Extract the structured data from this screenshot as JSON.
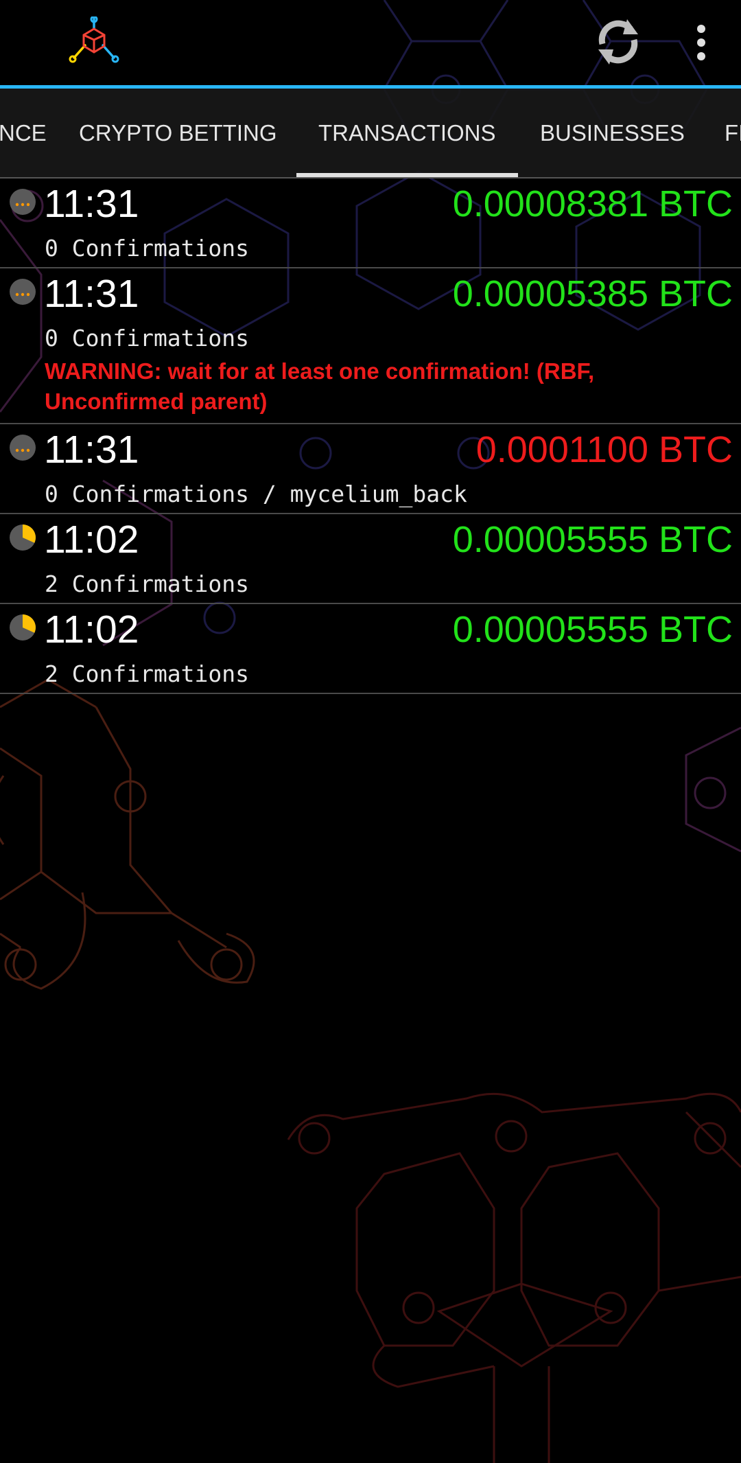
{
  "header": {
    "logo_icon": "mycelium-logo-icon",
    "refresh_icon": "refresh-icon",
    "overflow_icon": "more-vert-icon",
    "accent_color": "#29b6f6"
  },
  "tabs": [
    {
      "label": "BALANCE",
      "visible_text": "NCE",
      "selected": false
    },
    {
      "label": "CRYPTO BETTING",
      "visible_text": "CRYPTO BETTING",
      "selected": false
    },
    {
      "label": "TRANSACTIONS",
      "visible_text": "TRANSACTIONS",
      "selected": true
    },
    {
      "label": "BUSINESSES",
      "visible_text": "BUSINESSES",
      "selected": false
    },
    {
      "label": "FIO",
      "visible_text": "FI",
      "selected": false
    }
  ],
  "transactions": [
    {
      "time": "11:31",
      "amount": "0.00008381 BTC",
      "direction": "incoming",
      "confirmations": "0 Confirmations",
      "status_icon": "pending-dots-icon",
      "warning": ""
    },
    {
      "time": "11:31",
      "amount": "0.00005385 BTC",
      "direction": "incoming",
      "confirmations": "0 Confirmations",
      "status_icon": "pending-dots-icon",
      "warning": "WARNING: wait for at least one confirmation! (RBF, Unconfirmed parent)"
    },
    {
      "time": "11:31",
      "amount": "0.0001100 BTC",
      "direction": "outgoing",
      "confirmations": "0 Confirmations / mycelium_back",
      "status_icon": "pending-dots-icon",
      "warning": ""
    },
    {
      "time": "11:02",
      "amount": "0.00005555 BTC",
      "direction": "incoming",
      "confirmations": "2 Confirmations",
      "status_icon": "confirmation-pie-icon",
      "warning": ""
    },
    {
      "time": "11:02",
      "amount": "0.00005555 BTC",
      "direction": "incoming",
      "confirmations": "2 Confirmations",
      "status_icon": "confirmation-pie-icon",
      "warning": ""
    }
  ],
  "colors": {
    "incoming": "#22e21a",
    "outgoing": "#ee1c1c",
    "pending_dots": "#ff9800",
    "confirm_fill": "#ffc107"
  }
}
